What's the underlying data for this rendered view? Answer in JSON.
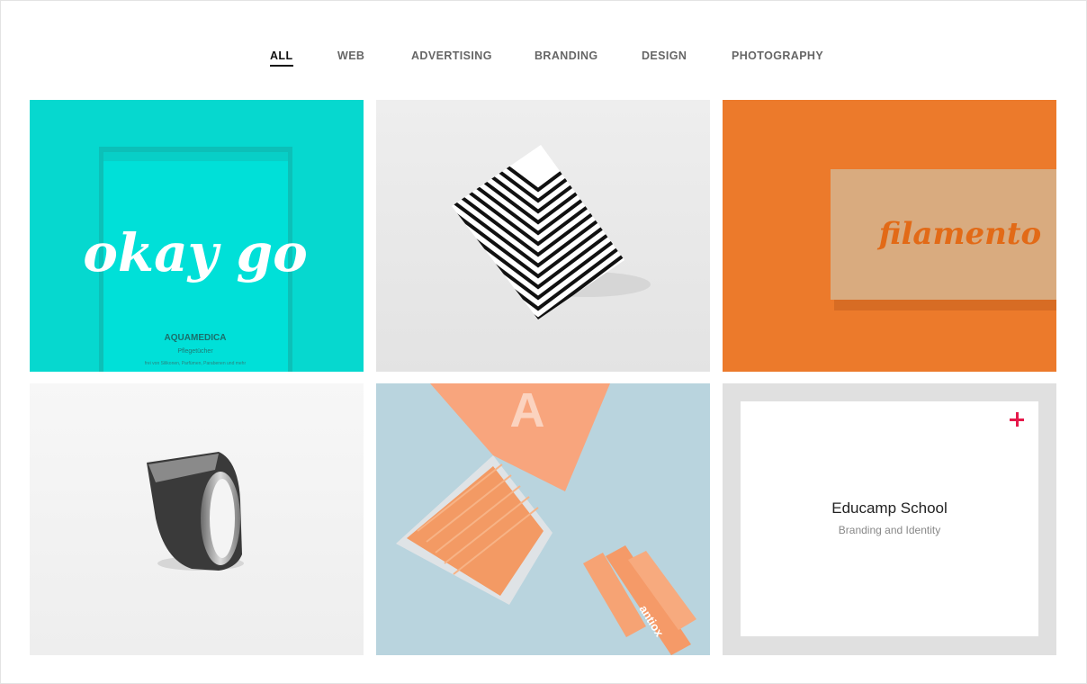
{
  "filters": {
    "items": [
      {
        "label": "ALL",
        "active": true
      },
      {
        "label": "WEB"
      },
      {
        "label": "ADVERTISING"
      },
      {
        "label": "BRANDING"
      },
      {
        "label": "DESIGN"
      },
      {
        "label": "PHOTOGRAPHY"
      }
    ]
  },
  "portfolio": {
    "tiles": [
      {
        "image_text": "okay go",
        "brand": "AQUAMEDICA",
        "subtitle": "Pflegetücher",
        "small_text": "frei von Silikonen, Parfümen, Parabenen und mehr"
      },
      {
        "image_text": ""
      },
      {
        "image_text": "filamento"
      },
      {
        "image_text": ""
      },
      {
        "image_text": "A",
        "pack_text": "antiox"
      },
      {
        "title": "Educamp School",
        "category": "Branding and Identity"
      }
    ]
  },
  "colors": {
    "accent": "#e6194b",
    "turquoise": "#00ddd6",
    "orange": "#ec7a2b",
    "peach": "#f7a27b",
    "light_blue": "#b8d3dd"
  },
  "icons": [
    "plus-icon"
  ]
}
